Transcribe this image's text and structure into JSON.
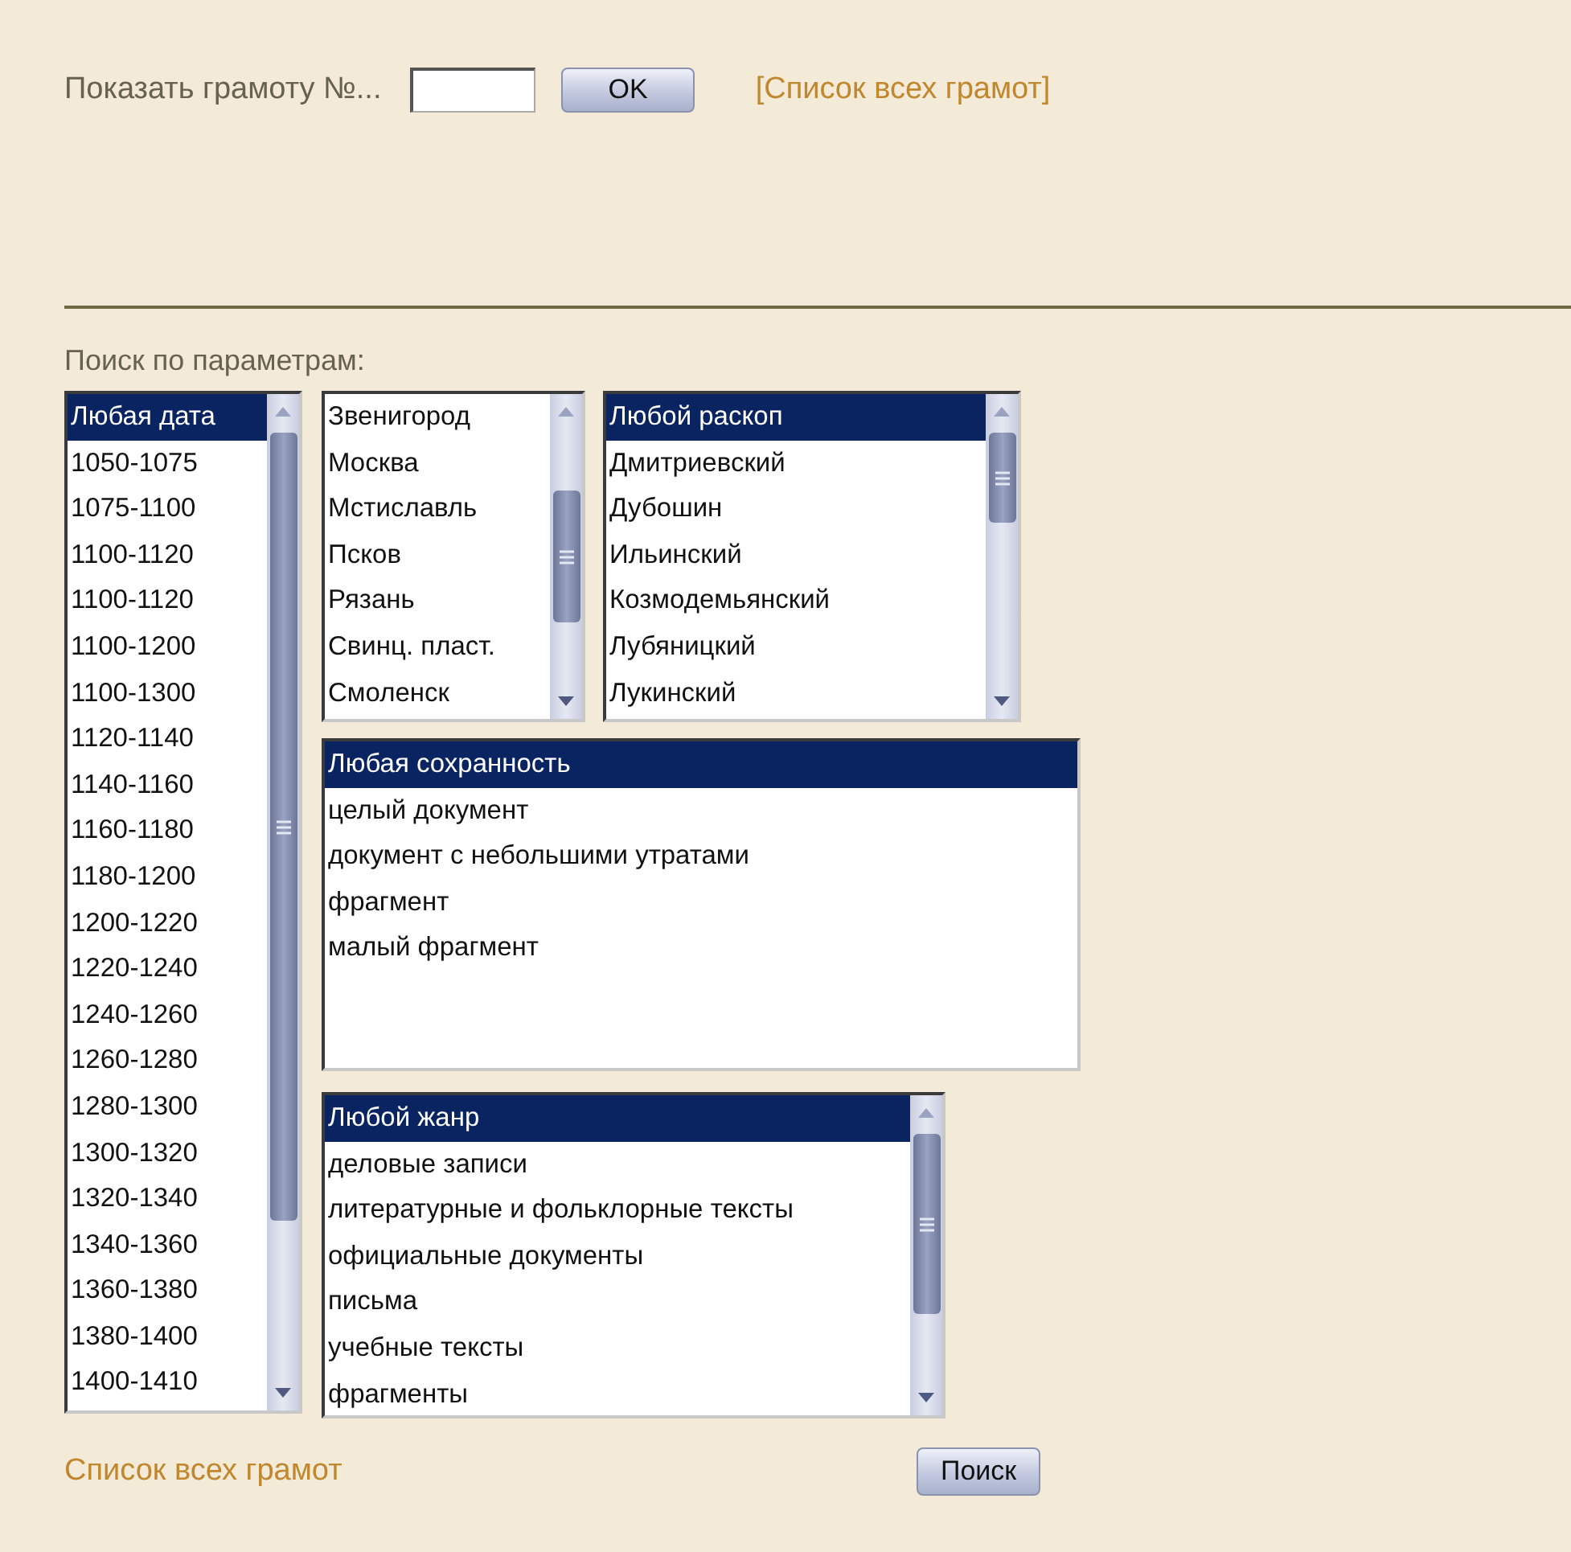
{
  "lookup": {
    "label": "Показать грамоту №...",
    "button": "OK",
    "link": "[Список всех грамот]"
  },
  "search": {
    "heading": "Поиск по параметрам:",
    "date_list": {
      "scrollable": true,
      "items": [
        {
          "label": "Любая дата",
          "selected": true
        },
        {
          "label": "1050-1075",
          "selected": false
        },
        {
          "label": "1075-1100",
          "selected": false
        },
        {
          "label": "1100-1120",
          "selected": false
        },
        {
          "label": "1100-1120",
          "selected": false
        },
        {
          "label": "1100-1200",
          "selected": false
        },
        {
          "label": "1100-1300",
          "selected": false
        },
        {
          "label": "1120-1140",
          "selected": false
        },
        {
          "label": "1140-1160",
          "selected": false
        },
        {
          "label": "1160-1180",
          "selected": false
        },
        {
          "label": "1180-1200",
          "selected": false
        },
        {
          "label": "1200-1220",
          "selected": false
        },
        {
          "label": "1220-1240",
          "selected": false
        },
        {
          "label": "1240-1260",
          "selected": false
        },
        {
          "label": "1260-1280",
          "selected": false
        },
        {
          "label": "1280-1300",
          "selected": false
        },
        {
          "label": "1300-1320",
          "selected": false
        },
        {
          "label": "1320-1340",
          "selected": false
        },
        {
          "label": "1340-1360",
          "selected": false
        },
        {
          "label": "1360-1380",
          "selected": false
        },
        {
          "label": "1380-1400",
          "selected": false
        },
        {
          "label": "1400-1410",
          "selected": false
        }
      ]
    },
    "city_list": {
      "scrollable": true,
      "items": [
        {
          "label": "Звенигород",
          "selected": false
        },
        {
          "label": "Москва",
          "selected": false
        },
        {
          "label": "Мстиславль",
          "selected": false
        },
        {
          "label": "Псков",
          "selected": false
        },
        {
          "label": "Рязань",
          "selected": false
        },
        {
          "label": "Свинц. пласт.",
          "selected": false
        },
        {
          "label": "Смоленск",
          "selected": false
        }
      ]
    },
    "excavation_list": {
      "scrollable": true,
      "items": [
        {
          "label": "Любой раскоп",
          "selected": true
        },
        {
          "label": "Дмитриевский",
          "selected": false
        },
        {
          "label": "Дубошин",
          "selected": false
        },
        {
          "label": "Ильинский",
          "selected": false
        },
        {
          "label": "Козмодемьянский",
          "selected": false
        },
        {
          "label": "Лубяницкий",
          "selected": false
        },
        {
          "label": "Лукинский",
          "selected": false
        }
      ]
    },
    "preservation_list": {
      "scrollable": false,
      "items": [
        {
          "label": "Любая сохранность",
          "selected": true
        },
        {
          "label": "целый документ",
          "selected": false
        },
        {
          "label": "документ с небольшими утратами",
          "selected": false
        },
        {
          "label": "фрагмент",
          "selected": false
        },
        {
          "label": "малый фрагмент",
          "selected": false
        }
      ]
    },
    "genre_list": {
      "scrollable": true,
      "items": [
        {
          "label": "Любой жанр",
          "selected": true
        },
        {
          "label": "деловые записи",
          "selected": false
        },
        {
          "label": "литературные и фольклорные тексты",
          "selected": false
        },
        {
          "label": "официальные документы",
          "selected": false
        },
        {
          "label": "письма",
          "selected": false
        },
        {
          "label": "учебные тексты",
          "selected": false
        },
        {
          "label": "фрагменты",
          "selected": false
        }
      ]
    },
    "footer_link": "Список всех грамот",
    "search_button": "Поиск"
  }
}
